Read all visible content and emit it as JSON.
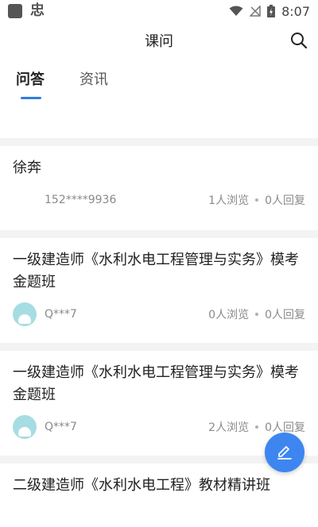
{
  "status_bar": {
    "app_glyph": "忠",
    "time": "8:07",
    "icons": [
      "wifi-icon",
      "no-signal-icon",
      "battery-charging-icon"
    ]
  },
  "header": {
    "title": "课问",
    "search_icon": "search-icon"
  },
  "tabs": [
    {
      "label": "问答",
      "active": true
    },
    {
      "label": "资讯",
      "active": false
    }
  ],
  "accent_color": "#2f7de1",
  "fab": {
    "icon": "edit-icon",
    "color": "#3d86f0"
  },
  "posts": [
    {
      "title": "徐奔",
      "author": "152****9936",
      "has_avatar": false,
      "views": "1人浏览",
      "replies": "0人回复"
    },
    {
      "title": "一级建造师《水利水电工程管理与实务》模考金题班",
      "author": "Q***7",
      "has_avatar": true,
      "views": "0人浏览",
      "replies": "0人回复"
    },
    {
      "title": "一级建造师《水利水电工程管理与实务》模考金题班",
      "author": "Q***7",
      "has_avatar": true,
      "views": "2人浏览",
      "replies": "0人回复"
    },
    {
      "title": "二级建造师《水利水电工程》教材精讲班"
    }
  ]
}
